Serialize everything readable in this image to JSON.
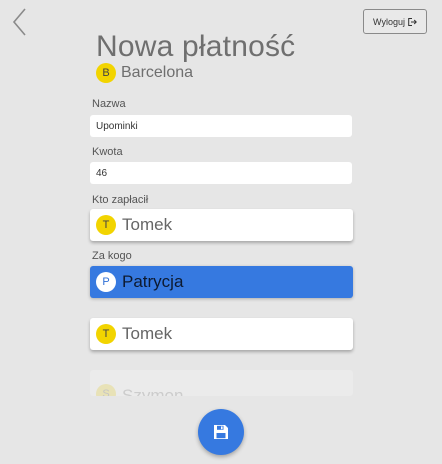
{
  "header": {
    "back_icon": "chevron-left-icon",
    "logout_label": "Wyloguj",
    "logout_icon": "sign-out-icon"
  },
  "page": {
    "title": "Nowa płatność"
  },
  "group": {
    "initial": "B",
    "name": "Barcelona"
  },
  "form": {
    "name_label": "Nazwa",
    "name_value": "Upominki",
    "amount_label": "Kwota",
    "amount_value": "46",
    "payer_label": "Kto zapłacił",
    "payer": {
      "initial": "T",
      "name": "Tomek"
    },
    "for_whom_label": "Za kogo",
    "for_whom": [
      {
        "initial": "P",
        "name": "Patrycja",
        "selected": true
      },
      {
        "initial": "T",
        "name": "Tomek",
        "selected": false
      },
      {
        "initial": "S",
        "name": "Szymon",
        "selected": false
      }
    ]
  },
  "actions": {
    "save_icon": "floppy-disk-icon"
  },
  "colors": {
    "background": "#e6e6e6",
    "accent": "#3679e0",
    "badge": "#f2d400"
  }
}
